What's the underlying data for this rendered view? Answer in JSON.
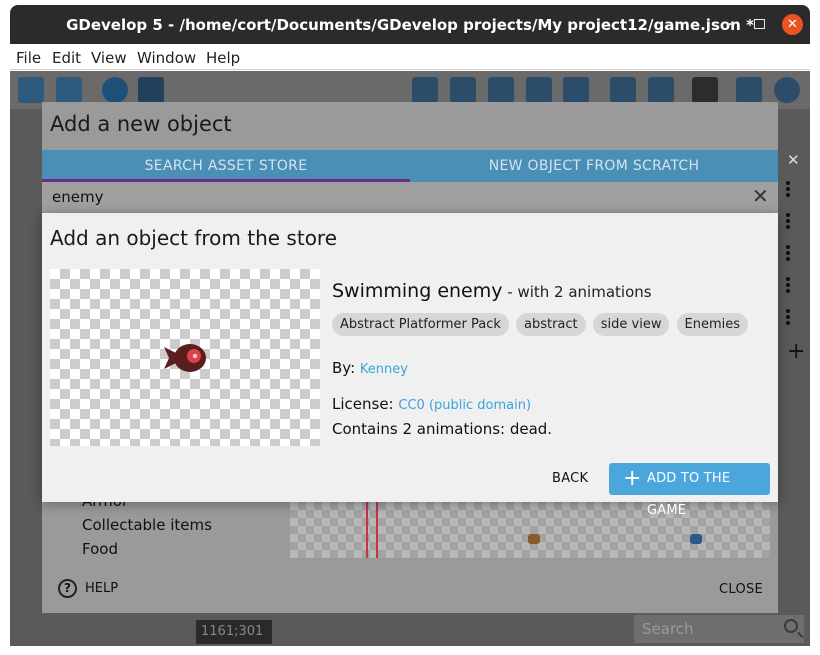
{
  "window": {
    "title": "GDevelop 5 - /home/cort/Documents/GDevelop projects/My project12/game.json *",
    "minimize_glyph": "–",
    "close_glyph": "✕"
  },
  "menubar": {
    "items": [
      "File",
      "Edit",
      "View",
      "Window",
      "Help"
    ]
  },
  "background": {
    "coords": "1161;301",
    "search_placeholder": "Search",
    "categories": [
      "Armor",
      "Collectable items",
      "Food"
    ]
  },
  "new_object_dialog": {
    "title": "Add a new object",
    "tabs": [
      "SEARCH ASSET STORE",
      "NEW OBJECT FROM SCRATCH"
    ],
    "active_tab": 0,
    "search_value": "enemy",
    "help_label": "HELP",
    "close_label": "CLOSE"
  },
  "store_dialog": {
    "title": "Add an object from the store",
    "asset": {
      "name": "Swimming enemy",
      "subtitle": " - with 2 animations",
      "tags": [
        "Abstract Platformer Pack",
        "abstract",
        "side view",
        "Enemies"
      ],
      "author_label": "By:",
      "author": "Kenney",
      "license_label": "License:",
      "license": "CC0 (public domain)",
      "contains": "Contains 2 animations: dead."
    },
    "back_label": "BACK",
    "add_label": "ADD TO THE GAME"
  },
  "colors": {
    "accent": "#4ba6db",
    "tab_indicator": "#6b2d8a",
    "close_button": "#e95420"
  }
}
